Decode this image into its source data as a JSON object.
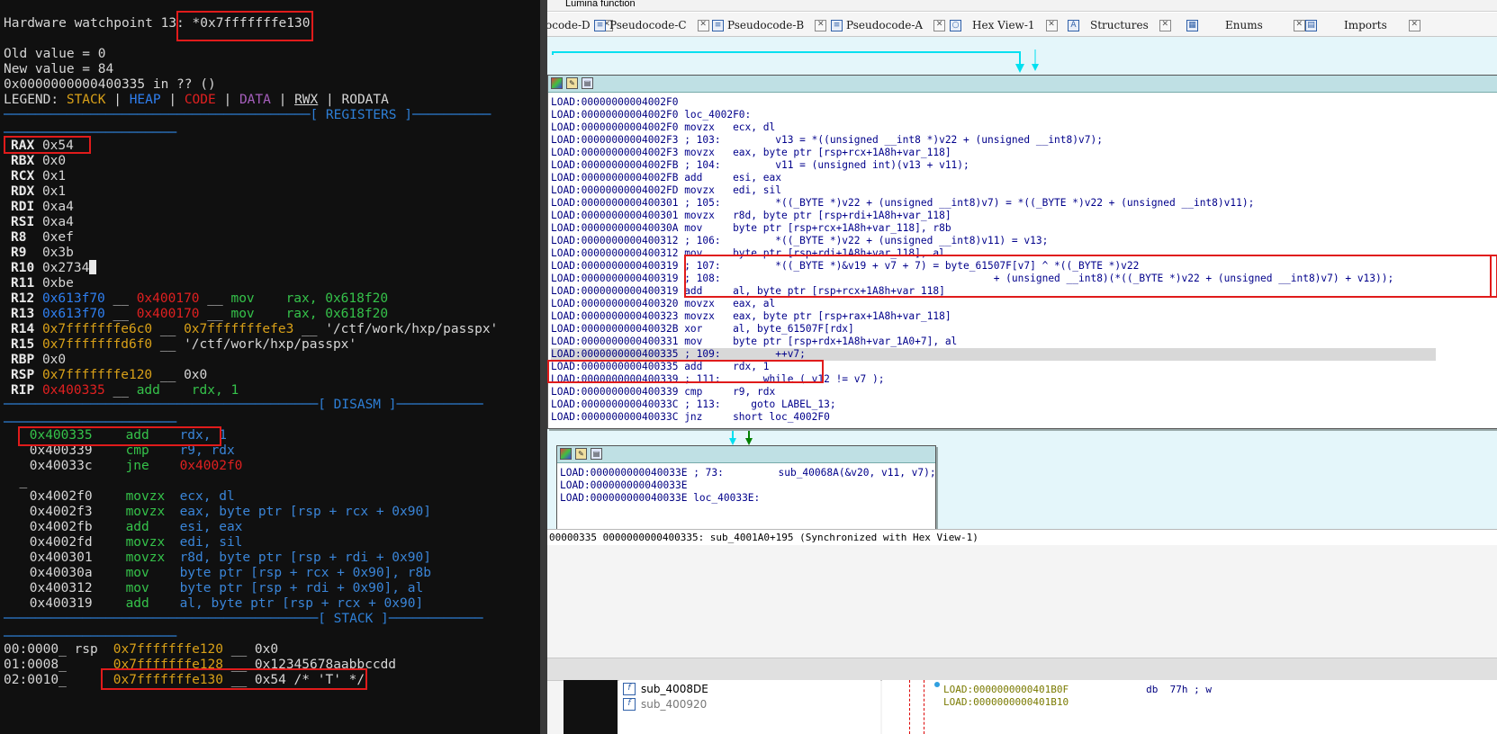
{
  "terminal": {
    "watchpoint_prefix": "Hardware watchpoint 13: ",
    "watchpoint_expr": "*0x7fffffffe130",
    "old_value": "Old value = 0",
    "new_value": "New value = 84",
    "location": "0x0000000000400335 in ?? ()",
    "legend_prefix": "LEGEND: ",
    "legend": {
      "stack": "STACK",
      "heap": "HEAP",
      "code": "CODE",
      "data": "DATA",
      "rwx": "RWX",
      "rodata": "RODATA"
    },
    "legend_sep": " | ",
    "sections": {
      "registers": "[ REGISTERS ]",
      "disasm": "[ DISASM ]",
      "stack": "[ STACK ]"
    },
    "registers": [
      {
        "name": "RAX",
        "value": "0x54"
      },
      {
        "name": "RBX",
        "value": "0x0"
      },
      {
        "name": "RCX",
        "value": "0x1"
      },
      {
        "name": "RDX",
        "value": "0x1"
      },
      {
        "name": "RDI",
        "value": "0xa4"
      },
      {
        "name": "RSI",
        "value": "0xa4"
      },
      {
        "name": "R8",
        "value": "0xef"
      },
      {
        "name": "R9",
        "value": "0x3b"
      },
      {
        "name": "R10",
        "value": "0x2734"
      },
      {
        "name": "R11",
        "value": "0xbe"
      },
      {
        "name": "R12",
        "v1": "0x613f70",
        "s1": " __ ",
        "v2": "0x400170",
        "s2": " __ ",
        "v3": "mov    rax, 0x618f20"
      },
      {
        "name": "R13",
        "v1": "0x613f70",
        "s1": " __ ",
        "v2": "0x400170",
        "s2": " __ ",
        "v3": "mov    rax, 0x618f20"
      },
      {
        "name": "R14",
        "v1": "0x7fffffffe6c0",
        "s1": " __ ",
        "v2": "0x7fffffffefe3",
        "s2": " __ ",
        "v3": "'/ctf/work/hxp/passpx'"
      },
      {
        "name": "R15",
        "v1": "0x7fffffffd6f0",
        "s1": " __ ",
        "v3": "'/ctf/work/hxp/passpx'"
      },
      {
        "name": "RBP",
        "value": "0x0"
      },
      {
        "name": "RSP",
        "v1": "0x7fffffffe120",
        "s1": " __ ",
        "v3": "0x0"
      },
      {
        "name": "RIP",
        "v1": "0x400335",
        "s1": " __ ",
        "v3": "add    rdx, 1"
      }
    ],
    "disasm": [
      {
        "prefix": " ",
        "addr": "0x400335",
        "mn": "add",
        "ops": "rdx, 1"
      },
      {
        "prefix": " ",
        "addr": "0x400339",
        "mn": "cmp",
        "ops": "r9, rdx"
      },
      {
        "prefix": " ",
        "addr": "0x40033c",
        "mn": "jne",
        "ops": "0x4002f0"
      },
      {
        "prefix": "  _",
        "addr": "",
        "mn": "",
        "ops": ""
      },
      {
        "prefix": " ",
        "addr": "0x4002f0",
        "mn": "movzx",
        "ops": "ecx, dl"
      },
      {
        "prefix": " ",
        "addr": "0x4002f3",
        "mn": "movzx",
        "ops": "eax, byte ptr [rsp + rcx + 0x90]"
      },
      {
        "prefix": " ",
        "addr": "0x4002fb",
        "mn": "add",
        "ops": "esi, eax"
      },
      {
        "prefix": " ",
        "addr": "0x4002fd",
        "mn": "movzx",
        "ops": "edi, sil"
      },
      {
        "prefix": " ",
        "addr": "0x400301",
        "mn": "movzx",
        "ops": "r8d, byte ptr [rsp + rdi + 0x90]"
      },
      {
        "prefix": " ",
        "addr": "0x40030a",
        "mn": "mov",
        "ops": "byte ptr [rsp + rcx + 0x90], r8b"
      },
      {
        "prefix": " ",
        "addr": "0x400312",
        "mn": "mov",
        "ops": "byte ptr [rsp + rdi + 0x90], al"
      },
      {
        "prefix": " ",
        "addr": "0x400319",
        "mn": "add",
        "ops": "al, byte ptr [rsp + rcx + 0x90]"
      }
    ],
    "stack": [
      {
        "idx": "00:0000_ rsp",
        "addr": "0x7fffffffe120",
        "rest": " __ 0x0"
      },
      {
        "idx": "01:0008_    ",
        "addr": "0x7fffffffe128",
        "rest": " __ 0x12345678aabbccdd"
      },
      {
        "idx": "02:0010_    ",
        "addr": "0x7fffffffe130",
        "rest": " __ 0x54 /* 'T' */"
      }
    ]
  },
  "ida": {
    "title": "Lumina function",
    "tabs": [
      {
        "label": "ocode-D",
        "icon": ""
      },
      {
        "label": "Pseudocode-C",
        "icon": "pseudocode-icon"
      },
      {
        "label": "Pseudocode-B",
        "icon": "pseudocode-icon"
      },
      {
        "label": "Pseudocode-A",
        "icon": "pseudocode-icon"
      },
      {
        "label": "Hex View-1",
        "icon": "hex-icon"
      },
      {
        "label": "Structures",
        "icon": "structures-icon"
      },
      {
        "label": "Enums",
        "icon": "enums-icon"
      },
      {
        "label": "Imports",
        "icon": "imports-icon"
      }
    ],
    "node1_lines": [
      {
        "seg": "LOAD:00000000004002F0",
        "text": ""
      },
      {
        "seg": "LOAD:00000000004002F0",
        "text": " loc_4002F0:"
      },
      {
        "seg": "LOAD:00000000004002F0",
        "text": " movzx   ecx, dl"
      },
      {
        "seg": "LOAD:00000000004002F3",
        "text": " ; 103:         v13 = *((unsigned __int8 *)v22 + (unsigned __int8)v7);"
      },
      {
        "seg": "LOAD:00000000004002F3",
        "text": " movzx   eax, byte ptr [rsp+rcx+1A8h+var_118]"
      },
      {
        "seg": "LOAD:00000000004002FB",
        "text": " ; 104:         v11 = (unsigned int)(v13 + v11);"
      },
      {
        "seg": "LOAD:00000000004002FB",
        "text": " add     esi, eax"
      },
      {
        "seg": "LOAD:00000000004002FD",
        "text": " movzx   edi, sil"
      },
      {
        "seg": "LOAD:0000000000400301",
        "text": " ; 105:         *((_BYTE *)v22 + (unsigned __int8)v7) = *((_BYTE *)v22 + (unsigned __int8)v11);"
      },
      {
        "seg": "LOAD:0000000000400301",
        "text": " movzx   r8d, byte ptr [rsp+rdi+1A8h+var_118]"
      },
      {
        "seg": "LOAD:000000000040030A",
        "text": " mov     byte ptr [rsp+rcx+1A8h+var_118], r8b"
      },
      {
        "seg": "LOAD:0000000000400312",
        "text": " ; 106:         *((_BYTE *)v22 + (unsigned __int8)v11) = v13;"
      },
      {
        "seg": "LOAD:0000000000400312",
        "text": " mov     byte ptr [rsp+rdi+1A8h+var_118], al"
      },
      {
        "seg": "LOAD:0000000000400319",
        "text": " ; 107:         *((_BYTE *)&v19 + v7 + 7) = byte_61507F[v7] ^ *((_BYTE *)v22"
      },
      {
        "seg": "LOAD:0000000000400319",
        "text": " ; 108:                                             + (unsigned __int8)(*((_BYTE *)v22 + (unsigned __int8)v7) + v13));"
      },
      {
        "seg": "LOAD:0000000000400319",
        "text": " add     al, byte ptr [rsp+rcx+1A8h+var_118]"
      },
      {
        "seg": "LOAD:0000000000400320",
        "text": " movzx   eax, al"
      },
      {
        "seg": "LOAD:0000000000400323",
        "text": " movzx   eax, byte ptr [rsp+rax+1A8h+var_118]"
      },
      {
        "seg": "LOAD:000000000040032B",
        "text": " xor     al, byte_61507F[rdx]"
      },
      {
        "seg": "LOAD:0000000000400331",
        "text": " mov     byte ptr [rsp+rdx+1A8h+var_1A0+7], al"
      },
      {
        "seg": "LOAD:0000000000400335",
        "text": " ; 109:         ++v7;"
      },
      {
        "seg": "LOAD:0000000000400335",
        "text": " add     rdx, 1"
      },
      {
        "seg": "LOAD:0000000000400339",
        "text": " ; 111:       while ( v12 != v7 );"
      },
      {
        "seg": "LOAD:0000000000400339",
        "text": " cmp     r9, rdx"
      },
      {
        "seg": "LOAD:000000000040033C",
        "text": " ; 113:     goto LABEL_13;"
      },
      {
        "seg": "LOAD:000000000040033C",
        "text": " jnz     short loc_4002F0"
      }
    ],
    "node2_lines": [
      {
        "seg": "LOAD:000000000040033E",
        "text": " ; 73:         sub_40068A(&v20, v11, v7);"
      },
      {
        "seg": "LOAD:000000000040033E",
        "text": ""
      },
      {
        "seg": "LOAD:000000000040033E",
        "text": " loc_40033E:"
      }
    ],
    "status": "00000335 0000000000400335: sub_4001A0+195 (Synchronized with Hex View-1)",
    "functions": [
      "sub_4008DE",
      "sub_400920"
    ],
    "hex_lines": [
      {
        "addr": "LOAD:0000000000401B0F",
        "rest": "             db  77h ; w"
      },
      {
        "addr": "LOAD:0000000000401B10",
        "rest": ""
      }
    ]
  }
}
